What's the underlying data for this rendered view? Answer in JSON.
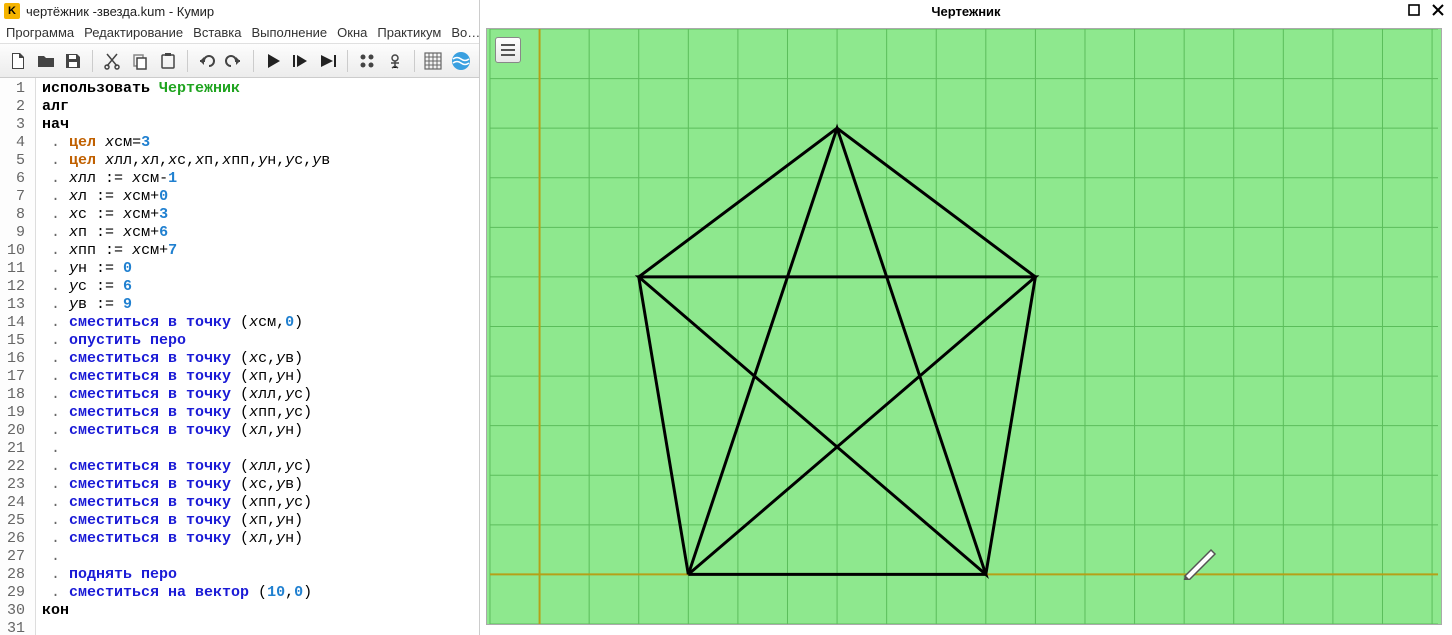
{
  "app": {
    "icon_letter": "K",
    "title": "чертёжник -звезда.kum - Кумир"
  },
  "menu": {
    "items": [
      "Программа",
      "Редактирование",
      "Вставка",
      "Выполнение",
      "Окна",
      "Практикум",
      "Во…"
    ]
  },
  "canvas": {
    "title": "Чертежник"
  },
  "code": {
    "lines": [
      [
        [
          "kw-use",
          "использовать "
        ],
        [
          "kw-module",
          "Чертежник"
        ]
      ],
      [
        [
          "kw-alg",
          "алг"
        ]
      ],
      [
        [
          "kw-begin",
          "нач"
        ]
      ],
      [
        [
          "kw-dot",
          " . "
        ],
        [
          "kw-type",
          "цел"
        ],
        [
          "kw-op",
          " "
        ],
        [
          "kw-var",
          "x"
        ],
        [
          "kw-op",
          "см="
        ],
        [
          "kw-num",
          "3"
        ]
      ],
      [
        [
          "kw-dot",
          " . "
        ],
        [
          "kw-type",
          "цел"
        ],
        [
          "kw-op",
          " "
        ],
        [
          "kw-var",
          "x"
        ],
        [
          "kw-op",
          "лл,"
        ],
        [
          "kw-var",
          "x"
        ],
        [
          "kw-op",
          "л,"
        ],
        [
          "kw-var",
          "x"
        ],
        [
          "kw-op",
          "с,"
        ],
        [
          "kw-var",
          "x"
        ],
        [
          "kw-op",
          "п,"
        ],
        [
          "kw-var",
          "x"
        ],
        [
          "kw-op",
          "пп,"
        ],
        [
          "kw-var",
          "y"
        ],
        [
          "kw-op",
          "н,"
        ],
        [
          "kw-var",
          "y"
        ],
        [
          "kw-op",
          "с,"
        ],
        [
          "kw-var",
          "y"
        ],
        [
          "kw-op",
          "в"
        ]
      ],
      [
        [
          "kw-dot",
          " . "
        ],
        [
          "kw-var",
          "x"
        ],
        [
          "kw-op",
          "лл := "
        ],
        [
          "kw-var",
          "x"
        ],
        [
          "kw-op",
          "см-"
        ],
        [
          "kw-num",
          "1"
        ]
      ],
      [
        [
          "kw-dot",
          " . "
        ],
        [
          "kw-var",
          "x"
        ],
        [
          "kw-op",
          "л := "
        ],
        [
          "kw-var",
          "x"
        ],
        [
          "kw-op",
          "см+"
        ],
        [
          "kw-num",
          "0"
        ]
      ],
      [
        [
          "kw-dot",
          " . "
        ],
        [
          "kw-var",
          "x"
        ],
        [
          "kw-op",
          "с := "
        ],
        [
          "kw-var",
          "x"
        ],
        [
          "kw-op",
          "см+"
        ],
        [
          "kw-num",
          "3"
        ]
      ],
      [
        [
          "kw-dot",
          " . "
        ],
        [
          "kw-var",
          "x"
        ],
        [
          "kw-op",
          "п := "
        ],
        [
          "kw-var",
          "x"
        ],
        [
          "kw-op",
          "см+"
        ],
        [
          "kw-num",
          "6"
        ]
      ],
      [
        [
          "kw-dot",
          " . "
        ],
        [
          "kw-var",
          "x"
        ],
        [
          "kw-op",
          "пп := "
        ],
        [
          "kw-var",
          "x"
        ],
        [
          "kw-op",
          "см+"
        ],
        [
          "kw-num",
          "7"
        ]
      ],
      [
        [
          "kw-dot",
          " . "
        ],
        [
          "kw-var",
          "y"
        ],
        [
          "kw-op",
          "н := "
        ],
        [
          "kw-num",
          "0"
        ]
      ],
      [
        [
          "kw-dot",
          " . "
        ],
        [
          "kw-var",
          "y"
        ],
        [
          "kw-op",
          "с := "
        ],
        [
          "kw-num",
          "6"
        ]
      ],
      [
        [
          "kw-dot",
          " . "
        ],
        [
          "kw-var",
          "y"
        ],
        [
          "kw-op",
          "в := "
        ],
        [
          "kw-num",
          "9"
        ]
      ],
      [
        [
          "kw-dot",
          " . "
        ],
        [
          "kw-cmd",
          "сместиться в точку"
        ],
        [
          "kw-op",
          " ("
        ],
        [
          "kw-var",
          "x"
        ],
        [
          "kw-op",
          "см,"
        ],
        [
          "kw-num",
          "0"
        ],
        [
          "kw-op",
          ")"
        ]
      ],
      [
        [
          "kw-dot",
          " . "
        ],
        [
          "kw-cmd",
          "опустить перо"
        ]
      ],
      [
        [
          "kw-dot",
          " . "
        ],
        [
          "kw-cmd",
          "сместиться в точку"
        ],
        [
          "kw-op",
          " ("
        ],
        [
          "kw-var",
          "x"
        ],
        [
          "kw-op",
          "с,"
        ],
        [
          "kw-var",
          "y"
        ],
        [
          "kw-op",
          "в)"
        ]
      ],
      [
        [
          "kw-dot",
          " . "
        ],
        [
          "kw-cmd",
          "сместиться в точку"
        ],
        [
          "kw-op",
          " ("
        ],
        [
          "kw-var",
          "x"
        ],
        [
          "kw-op",
          "п,"
        ],
        [
          "kw-var",
          "y"
        ],
        [
          "kw-op",
          "н)"
        ]
      ],
      [
        [
          "kw-dot",
          " . "
        ],
        [
          "kw-cmd",
          "сместиться в точку"
        ],
        [
          "kw-op",
          " ("
        ],
        [
          "kw-var",
          "x"
        ],
        [
          "kw-op",
          "лл,"
        ],
        [
          "kw-var",
          "y"
        ],
        [
          "kw-op",
          "с)"
        ]
      ],
      [
        [
          "kw-dot",
          " . "
        ],
        [
          "kw-cmd",
          "сместиться в точку"
        ],
        [
          "kw-op",
          " ("
        ],
        [
          "kw-var",
          "x"
        ],
        [
          "kw-op",
          "пп,"
        ],
        [
          "kw-var",
          "y"
        ],
        [
          "kw-op",
          "с)"
        ]
      ],
      [
        [
          "kw-dot",
          " . "
        ],
        [
          "kw-cmd",
          "сместиться в точку"
        ],
        [
          "kw-op",
          " ("
        ],
        [
          "kw-var",
          "x"
        ],
        [
          "kw-op",
          "л,"
        ],
        [
          "kw-var",
          "y"
        ],
        [
          "kw-op",
          "н)"
        ]
      ],
      [
        [
          "kw-dot",
          " ."
        ]
      ],
      [
        [
          "kw-dot",
          " . "
        ],
        [
          "kw-cmd",
          "сместиться в точку"
        ],
        [
          "kw-op",
          " ("
        ],
        [
          "kw-var",
          "x"
        ],
        [
          "kw-op",
          "лл,"
        ],
        [
          "kw-var",
          "y"
        ],
        [
          "kw-op",
          "с)"
        ]
      ],
      [
        [
          "kw-dot",
          " . "
        ],
        [
          "kw-cmd",
          "сместиться в точку"
        ],
        [
          "kw-op",
          " ("
        ],
        [
          "kw-var",
          "x"
        ],
        [
          "kw-op",
          "с,"
        ],
        [
          "kw-var",
          "y"
        ],
        [
          "kw-op",
          "в)"
        ]
      ],
      [
        [
          "kw-dot",
          " . "
        ],
        [
          "kw-cmd",
          "сместиться в точку"
        ],
        [
          "kw-op",
          " ("
        ],
        [
          "kw-var",
          "x"
        ],
        [
          "kw-op",
          "пп,"
        ],
        [
          "kw-var",
          "y"
        ],
        [
          "kw-op",
          "с)"
        ]
      ],
      [
        [
          "kw-dot",
          " . "
        ],
        [
          "kw-cmd",
          "сместиться в точку"
        ],
        [
          "kw-op",
          " ("
        ],
        [
          "kw-var",
          "x"
        ],
        [
          "kw-op",
          "п,"
        ],
        [
          "kw-var",
          "y"
        ],
        [
          "kw-op",
          "н)"
        ]
      ],
      [
        [
          "kw-dot",
          " . "
        ],
        [
          "kw-cmd",
          "сместиться в точку"
        ],
        [
          "kw-op",
          " ("
        ],
        [
          "kw-var",
          "x"
        ],
        [
          "kw-op",
          "л,"
        ],
        [
          "kw-var",
          "y"
        ],
        [
          "kw-op",
          "н)"
        ]
      ],
      [
        [
          "kw-dot",
          " ."
        ]
      ],
      [
        [
          "kw-dot",
          " . "
        ],
        [
          "kw-cmd",
          "поднять перо"
        ]
      ],
      [
        [
          "kw-dot",
          " . "
        ],
        [
          "kw-cmd",
          "сместиться на вектор"
        ],
        [
          "kw-op",
          " ("
        ],
        [
          "kw-num",
          "10"
        ],
        [
          "kw-op",
          ","
        ],
        [
          "kw-num",
          "0"
        ],
        [
          "kw-op",
          ")"
        ]
      ],
      [
        [
          "kw-end",
          "кон"
        ]
      ],
      [
        [
          "kw-op",
          ""
        ]
      ]
    ],
    "line_count": 31
  },
  "drawing": {
    "grid_cell": 50,
    "origin_x_units": -1,
    "origin_y_units": -1,
    "star_points_units": [
      [
        3,
        0
      ],
      [
        6,
        9
      ],
      [
        9,
        0
      ],
      [
        2,
        6
      ],
      [
        10,
        6
      ],
      [
        3,
        0
      ]
    ],
    "pentagon_points_units": [
      [
        3,
        0
      ],
      [
        2,
        6
      ],
      [
        6,
        9
      ],
      [
        10,
        6
      ],
      [
        9,
        0
      ],
      [
        3,
        0
      ]
    ],
    "pen_pos_units": [
      13,
      0
    ]
  }
}
